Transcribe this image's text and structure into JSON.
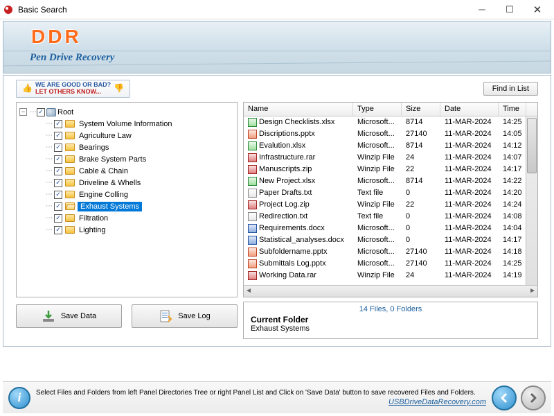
{
  "window": {
    "title": "Basic Search"
  },
  "banner": {
    "brand": "DDR",
    "subtitle": "Pen Drive Recovery"
  },
  "tagline": {
    "line1": "WE ARE GOOD OR BAD?",
    "line2": "LET OTHERS KNOW..."
  },
  "buttons": {
    "find_in_list": "Find in List",
    "save_data": "Save Data",
    "save_log": "Save Log"
  },
  "tree": {
    "root_label": "Root",
    "items": [
      {
        "label": "System Volume Information",
        "checked": true
      },
      {
        "label": "Agriculture Law",
        "checked": true
      },
      {
        "label": "Bearings",
        "checked": true
      },
      {
        "label": "Brake System Parts",
        "checked": true
      },
      {
        "label": "Cable & Chain",
        "checked": true
      },
      {
        "label": "Driveline & Whells",
        "checked": true
      },
      {
        "label": "Engine Colling",
        "checked": true
      },
      {
        "label": "Exhaust Systems",
        "checked": true,
        "selected": true
      },
      {
        "label": "Filtration",
        "checked": true
      },
      {
        "label": "Lighting",
        "checked": true
      }
    ]
  },
  "file_headers": {
    "name": "Name",
    "type": "Type",
    "size": "Size",
    "date": "Date",
    "time": "Time"
  },
  "files": [
    {
      "icon": "xlsx",
      "name": "Design Checklists.xlsx",
      "type": "Microsoft...",
      "size": "8714",
      "date": "11-MAR-2024",
      "time": "14:25"
    },
    {
      "icon": "pptx",
      "name": "Discriptions.pptx",
      "type": "Microsoft...",
      "size": "27140",
      "date": "11-MAR-2024",
      "time": "14:05"
    },
    {
      "icon": "xlsx",
      "name": "Evalution.xlsx",
      "type": "Microsoft...",
      "size": "8714",
      "date": "11-MAR-2024",
      "time": "14:12"
    },
    {
      "icon": "rar",
      "name": "Infrastructure.rar",
      "type": "Winzip File",
      "size": "24",
      "date": "11-MAR-2024",
      "time": "14:07"
    },
    {
      "icon": "zip",
      "name": "Manuscripts.zip",
      "type": "Winzip File",
      "size": "22",
      "date": "11-MAR-2024",
      "time": "14:17"
    },
    {
      "icon": "xlsx",
      "name": "New Project.xlsx",
      "type": "Microsoft...",
      "size": "8714",
      "date": "11-MAR-2024",
      "time": "14:22"
    },
    {
      "icon": "txt",
      "name": "Paper Drafts.txt",
      "type": "Text file",
      "size": "0",
      "date": "11-MAR-2024",
      "time": "14:20"
    },
    {
      "icon": "zip",
      "name": "Project Log.zip",
      "type": "Winzip File",
      "size": "22",
      "date": "11-MAR-2024",
      "time": "14:24"
    },
    {
      "icon": "txt",
      "name": "Redirection.txt",
      "type": "Text file",
      "size": "0",
      "date": "11-MAR-2024",
      "time": "14:08"
    },
    {
      "icon": "docx",
      "name": "Requirements.docx",
      "type": "Microsoft...",
      "size": "0",
      "date": "11-MAR-2024",
      "time": "14:04"
    },
    {
      "icon": "docx",
      "name": "Statistical_analyses.docx",
      "type": "Microsoft...",
      "size": "0",
      "date": "11-MAR-2024",
      "time": "14:17"
    },
    {
      "icon": "pptx",
      "name": "Subfoldername.pptx",
      "type": "Microsoft...",
      "size": "27140",
      "date": "11-MAR-2024",
      "time": "14:18"
    },
    {
      "icon": "pptx",
      "name": "Submittals Log.pptx",
      "type": "Microsoft...",
      "size": "27140",
      "date": "11-MAR-2024",
      "time": "14:25"
    },
    {
      "icon": "rar",
      "name": "Working Data.rar",
      "type": "Winzip File",
      "size": "24",
      "date": "11-MAR-2024",
      "time": "14:19"
    }
  ],
  "summary": "14 Files, 0 Folders",
  "current_folder": {
    "label": "Current Folder",
    "value": "Exhaust Systems"
  },
  "footer": {
    "help_text": "Select Files and Folders from left Panel Directories Tree or right Panel List and Click on 'Save Data' button to save recovered Files and Folders.",
    "link": "USBDriveDataRecovery.com"
  }
}
